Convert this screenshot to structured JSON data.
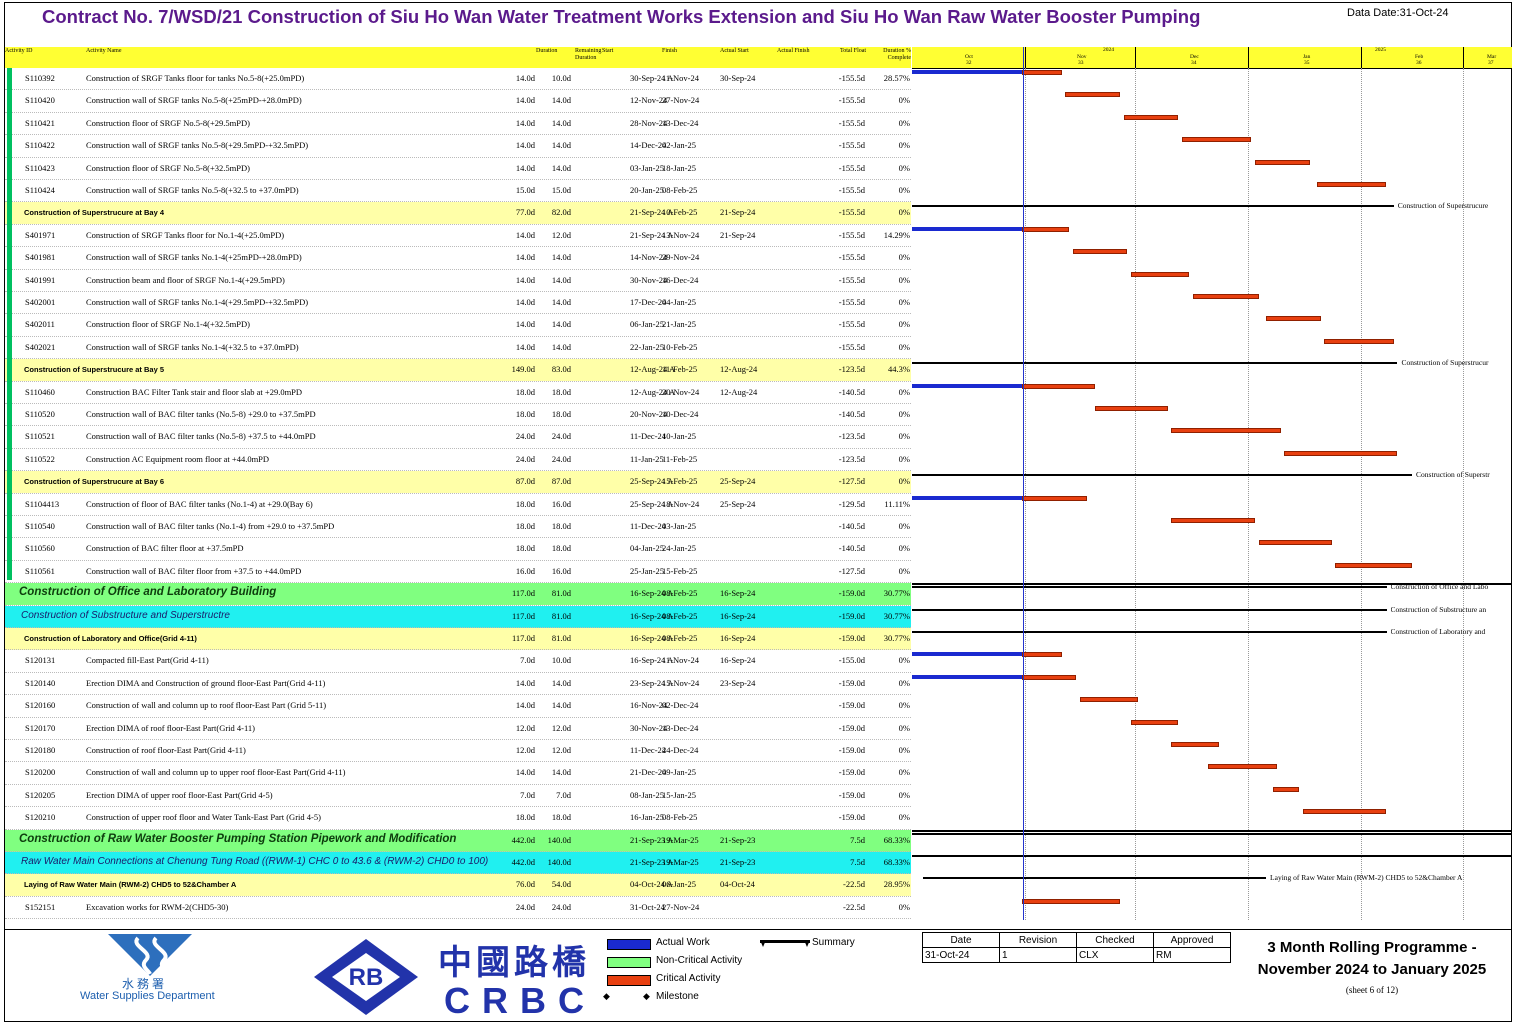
{
  "header": {
    "title": "Contract No. 7/WSD/21 Construction of Siu Ho Wan Water Treatment Works Extension and Siu Ho Wan Raw Water Booster Pumping",
    "data_date": "Data Date:31-Oct-24"
  },
  "columns": {
    "id": "Activity ID",
    "name": "Activity Name",
    "od": "Duration",
    "rd": "Remaining Duration",
    "start": "Start",
    "finish": "Finish",
    "as": "Actual Start",
    "af": "Actual Finish",
    "tf": "Total Float",
    "pc": "Duration % Complete"
  },
  "timescale": {
    "years": [
      "2024",
      "2025"
    ],
    "months": [
      "Oct",
      "Nov",
      "Dec",
      "Jan",
      "Feb",
      "Mar"
    ],
    "weeks": [
      "32",
      "33",
      "34",
      "35",
      "36",
      "37"
    ]
  },
  "rows": [
    {
      "type": "task",
      "id": "S110392",
      "name": "Construction of SRGF Tanks floor for tanks No.5-8(+25.0mPD)",
      "od": "14.0d",
      "rd": "10.0d",
      "start": "30-Sep-24 A",
      "finish": "11-Nov-24",
      "as": "30-Sep-24",
      "tf": "-155.5d",
      "pc": "28.57%"
    },
    {
      "type": "task",
      "id": "S110420",
      "name": "Construction wall of SRGF tanks No.5-8(+25mPD-+28.0mPD)",
      "od": "14.0d",
      "rd": "14.0d",
      "start": "12-Nov-24",
      "finish": "27-Nov-24",
      "as": "",
      "tf": "-155.5d",
      "pc": "0%"
    },
    {
      "type": "task",
      "id": "S110421",
      "name": "Construction floor of SRGF No.5-8(+29.5mPD)",
      "od": "14.0d",
      "rd": "14.0d",
      "start": "28-Nov-24",
      "finish": "13-Dec-24",
      "as": "",
      "tf": "-155.5d",
      "pc": "0%"
    },
    {
      "type": "task",
      "id": "S110422",
      "name": "Construction wall of SRGF tanks No.5-8(+29.5mPD-+32.5mPD)",
      "od": "14.0d",
      "rd": "14.0d",
      "start": "14-Dec-24",
      "finish": "02-Jan-25",
      "as": "",
      "tf": "-155.5d",
      "pc": "0%"
    },
    {
      "type": "task",
      "id": "S110423",
      "name": "Construction floor of SRGF No.5-8(+32.5mPD)",
      "od": "14.0d",
      "rd": "14.0d",
      "start": "03-Jan-25",
      "finish": "18-Jan-25",
      "as": "",
      "tf": "-155.5d",
      "pc": "0%"
    },
    {
      "type": "task",
      "id": "S110424",
      "name": "Construction wall of SRGF tanks No.5-8(+32.5 to +37.0mPD)",
      "od": "15.0d",
      "rd": "15.0d",
      "start": "20-Jan-25",
      "finish": "08-Feb-25",
      "as": "",
      "tf": "-155.5d",
      "pc": "0%"
    },
    {
      "type": "wbs3",
      "id": "",
      "name": "Construction of Superstrucure at Bay 4",
      "od": "77.0d",
      "rd": "82.0d",
      "start": "21-Sep-24 A",
      "finish": "10-Feb-25",
      "as": "21-Sep-24",
      "tf": "-155.5d",
      "pc": "0%",
      "label": "Construction of Superstrucure"
    },
    {
      "type": "task",
      "id": "S401971",
      "name": "Construction of SRGF Tanks floor for No.1-4(+25.0mPD)",
      "od": "14.0d",
      "rd": "12.0d",
      "start": "21-Sep-24 A",
      "finish": "13-Nov-24",
      "as": "21-Sep-24",
      "tf": "-155.5d",
      "pc": "14.29%"
    },
    {
      "type": "task",
      "id": "S401981",
      "name": "Construction wall of SRGF tanks No.1-4(+25mPD-+28.0mPD)",
      "od": "14.0d",
      "rd": "14.0d",
      "start": "14-Nov-24",
      "finish": "29-Nov-24",
      "as": "",
      "tf": "-155.5d",
      "pc": "0%"
    },
    {
      "type": "task",
      "id": "S401991",
      "name": "Construction beam and floor of SRGF No.1-4(+29.5mPD)",
      "od": "14.0d",
      "rd": "14.0d",
      "start": "30-Nov-24",
      "finish": "16-Dec-24",
      "as": "",
      "tf": "-155.5d",
      "pc": "0%"
    },
    {
      "type": "task",
      "id": "S402001",
      "name": "Construction wall of SRGF tanks No.1-4(+29.5mPD-+32.5mPD)",
      "od": "14.0d",
      "rd": "14.0d",
      "start": "17-Dec-24",
      "finish": "04-Jan-25",
      "as": "",
      "tf": "-155.5d",
      "pc": "0%"
    },
    {
      "type": "task",
      "id": "S402011",
      "name": "Construction floor of SRGF No.1-4(+32.5mPD)",
      "od": "14.0d",
      "rd": "14.0d",
      "start": "06-Jan-25",
      "finish": "21-Jan-25",
      "as": "",
      "tf": "-155.5d",
      "pc": "0%"
    },
    {
      "type": "task",
      "id": "S402021",
      "name": "Construction wall of SRGF tanks No.1-4(+32.5 to +37.0mPD)",
      "od": "14.0d",
      "rd": "14.0d",
      "start": "22-Jan-25",
      "finish": "10-Feb-25",
      "as": "",
      "tf": "-155.5d",
      "pc": "0%"
    },
    {
      "type": "wbs3",
      "id": "",
      "name": "Construction of Superstrucure at Bay 5",
      "od": "149.0d",
      "rd": "83.0d",
      "start": "12-Aug-24 A",
      "finish": "11-Feb-25",
      "as": "12-Aug-24",
      "tf": "-123.5d",
      "pc": "44.3%",
      "label": "Construction of Superstrucur"
    },
    {
      "type": "task",
      "id": "S110460",
      "name": "Construction BAC Filter Tank stair and floor slab at +29.0mPD",
      "od": "18.0d",
      "rd": "18.0d",
      "start": "12-Aug-24 A",
      "finish": "20-Nov-24",
      "as": "12-Aug-24",
      "tf": "-140.5d",
      "pc": "0%"
    },
    {
      "type": "task",
      "id": "S110520",
      "name": "Construction wall of BAC filter tanks (No.5-8) +29.0 to +37.5mPD",
      "od": "18.0d",
      "rd": "18.0d",
      "start": "20-Nov-24",
      "finish": "10-Dec-24",
      "as": "",
      "tf": "-140.5d",
      "pc": "0%"
    },
    {
      "type": "task",
      "id": "S110521",
      "name": "Construction wall of BAC filter tanks (No.5-8) +37.5 to +44.0mPD",
      "od": "24.0d",
      "rd": "24.0d",
      "start": "11-Dec-24",
      "finish": "10-Jan-25",
      "as": "",
      "tf": "-123.5d",
      "pc": "0%"
    },
    {
      "type": "task",
      "id": "S110522",
      "name": "Construction AC Equipment room floor at +44.0mPD",
      "od": "24.0d",
      "rd": "24.0d",
      "start": "11-Jan-25",
      "finish": "11-Feb-25",
      "as": "",
      "tf": "-123.5d",
      "pc": "0%"
    },
    {
      "type": "wbs3",
      "id": "",
      "name": "Construction of Superstrucure at Bay 6",
      "od": "87.0d",
      "rd": "87.0d",
      "start": "25-Sep-24 A",
      "finish": "15-Feb-25",
      "as": "25-Sep-24",
      "tf": "-127.5d",
      "pc": "0%",
      "label": "Construction of Superstr"
    },
    {
      "type": "task",
      "id": "S1104413",
      "name": "Construction of floor of BAC filter tanks (No.1-4) at +29.0(Bay 6)",
      "od": "18.0d",
      "rd": "16.0d",
      "start": "25-Sep-24 A",
      "finish": "18-Nov-24",
      "as": "25-Sep-24",
      "tf": "-129.5d",
      "pc": "11.11%"
    },
    {
      "type": "task",
      "id": "S110540",
      "name": "Construction wall of BAC filter tanks (No.1-4) from +29.0 to +37.5mPD",
      "od": "18.0d",
      "rd": "18.0d",
      "start": "11-Dec-24",
      "finish": "03-Jan-25",
      "as": "",
      "tf": "-140.5d",
      "pc": "0%"
    },
    {
      "type": "task",
      "id": "S110560",
      "name": "Construction of BAC filter floor at +37.5mPD",
      "od": "18.0d",
      "rd": "18.0d",
      "start": "04-Jan-25",
      "finish": "24-Jan-25",
      "as": "",
      "tf": "-140.5d",
      "pc": "0%"
    },
    {
      "type": "task",
      "id": "S110561",
      "name": "Construction wall of BAC filter floor from +37.5 to +44.0mPD",
      "od": "16.0d",
      "rd": "16.0d",
      "start": "25-Jan-25",
      "finish": "15-Feb-25",
      "as": "",
      "tf": "-127.5d",
      "pc": "0%"
    },
    {
      "type": "wbs1",
      "id": "",
      "name": "Construction of Office and Laboratory Building",
      "od": "117.0d",
      "rd": "81.0d",
      "start": "16-Sep-24 A",
      "finish": "08-Feb-25",
      "as": "16-Sep-24",
      "tf": "-159.0d",
      "pc": "30.77%",
      "label": "Construction of Office and Labo"
    },
    {
      "type": "wbs2",
      "id": "",
      "name": "Construction of Substructure and Superstructre",
      "od": "117.0d",
      "rd": "81.0d",
      "start": "16-Sep-24 A",
      "finish": "08-Feb-25",
      "as": "16-Sep-24",
      "tf": "-159.0d",
      "pc": "30.77%",
      "label": "Construction of Substructure an"
    },
    {
      "type": "wbs3",
      "id": "",
      "name": "Construction of Laboratory and Office(Grid 4-11)",
      "od": "117.0d",
      "rd": "81.0d",
      "start": "16-Sep-24 A",
      "finish": "08-Feb-25",
      "as": "16-Sep-24",
      "tf": "-159.0d",
      "pc": "30.77%",
      "label": "Construction of Laboratory and"
    },
    {
      "type": "task",
      "id": "S120131",
      "name": "Compacted fill-East Part(Grid 4-11)",
      "od": "7.0d",
      "rd": "10.0d",
      "start": "16-Sep-24 A",
      "finish": "11-Nov-24",
      "as": "16-Sep-24",
      "tf": "-155.0d",
      "pc": "0%"
    },
    {
      "type": "task",
      "id": "S120140",
      "name": "Erection DIMA and Construction of ground floor-East Part(Grid 4-11)",
      "od": "14.0d",
      "rd": "14.0d",
      "start": "23-Sep-24 A",
      "finish": "15-Nov-24",
      "as": "23-Sep-24",
      "tf": "-159.0d",
      "pc": "0%"
    },
    {
      "type": "task",
      "id": "S120160",
      "name": "Construction of wall and column up to roof floor-East Part (Grid 5-11)",
      "od": "14.0d",
      "rd": "14.0d",
      "start": "16-Nov-24",
      "finish": "02-Dec-24",
      "as": "",
      "tf": "-159.0d",
      "pc": "0%"
    },
    {
      "type": "task",
      "id": "S120170",
      "name": "Erection DIMA of roof floor-East Part(Grid 4-11)",
      "od": "12.0d",
      "rd": "12.0d",
      "start": "30-Nov-24",
      "finish": "13-Dec-24",
      "as": "",
      "tf": "-159.0d",
      "pc": "0%"
    },
    {
      "type": "task",
      "id": "S120180",
      "name": "Construction of roof floor-East Part(Grid 4-11)",
      "od": "12.0d",
      "rd": "12.0d",
      "start": "11-Dec-24",
      "finish": "24-Dec-24",
      "as": "",
      "tf": "-159.0d",
      "pc": "0%"
    },
    {
      "type": "task",
      "id": "S120200",
      "name": "Construction of wall and column up to upper roof floor-East Part(Grid 4-11)",
      "od": "14.0d",
      "rd": "14.0d",
      "start": "21-Dec-24",
      "finish": "09-Jan-25",
      "as": "",
      "tf": "-159.0d",
      "pc": "0%"
    },
    {
      "type": "task",
      "id": "S120205",
      "name": "Erection DIMA of upper roof floor-East Part(Grid 4-5)",
      "od": "7.0d",
      "rd": "7.0d",
      "start": "08-Jan-25",
      "finish": "15-Jan-25",
      "as": "",
      "tf": "-159.0d",
      "pc": "0%"
    },
    {
      "type": "task",
      "id": "S120210",
      "name": "Construction of upper roof floor and Water Tank-East Part (Grid 4-5)",
      "od": "18.0d",
      "rd": "18.0d",
      "start": "16-Jan-25",
      "finish": "08-Feb-25",
      "as": "",
      "tf": "-159.0d",
      "pc": "0%"
    },
    {
      "type": "wbs1",
      "id": "",
      "name": "Construction of Raw Water Booster Pumping Station Pipework and Modification",
      "od": "442.0d",
      "rd": "140.0d",
      "start": "21-Sep-23 A",
      "finish": "19-Mar-25",
      "as": "21-Sep-23",
      "tf": "7.5d",
      "pc": "68.33%",
      "label": ""
    },
    {
      "type": "wbs2",
      "id": "",
      "name": "Raw Water Main Connections at Chenung Tung Road ((RWM-1) CHC 0  to 43.6 & (RWM-2)  CHD0 to 100)",
      "od": "442.0d",
      "rd": "140.0d",
      "start": "21-Sep-23 A",
      "finish": "19-Mar-25",
      "as": "21-Sep-23",
      "tf": "7.5d",
      "pc": "68.33%",
      "label": ""
    },
    {
      "type": "wbs3",
      "id": "",
      "name": "Laying of Raw Water Main  (RWM-2)  CHD5 to 52&Chamber A",
      "od": "76.0d",
      "rd": "54.0d",
      "start": "04-Oct-24 A",
      "finish": "06-Jan-25",
      "as": "04-Oct-24",
      "tf": "-22.5d",
      "pc": "28.95%",
      "label": "Laying of Raw Water Main  (RWM-2)  CHD5 to 52&Chamber A"
    },
    {
      "type": "task",
      "id": "S152151",
      "name": "Excavation works for RWM-2(CHD5-30)",
      "od": "24.0d",
      "rd": "24.0d",
      "start": "31-Oct-24",
      "finish": "27-Nov-24",
      "as": "",
      "tf": "-22.5d",
      "pc": "0%"
    }
  ],
  "legend": {
    "actual": "Actual Work",
    "noncrit": "Non-Critical Activity",
    "crit": "Critical Activity",
    "milestone": "Milestone",
    "summary": "Summary",
    "colors": {
      "actual": "#1a2ad0",
      "noncrit": "#80ff80",
      "crit": "#e84010"
    }
  },
  "signoff": {
    "headers": [
      "Date",
      "Revision",
      "Checked",
      "Approved"
    ],
    "values": [
      "31-Oct-24",
      "1",
      "CLX",
      "RM"
    ]
  },
  "programme": {
    "line1": "3 Month Rolling Programme -",
    "line2": "November 2024 to January 2025",
    "sheet": "(sheet 6 of 12)"
  },
  "logos": {
    "wsd_cn": "水 務 署",
    "wsd_en": "Water Supplies Department",
    "rb": "RB",
    "crbc_cn": "中國路橋",
    "crbc_en": "CRBC"
  }
}
